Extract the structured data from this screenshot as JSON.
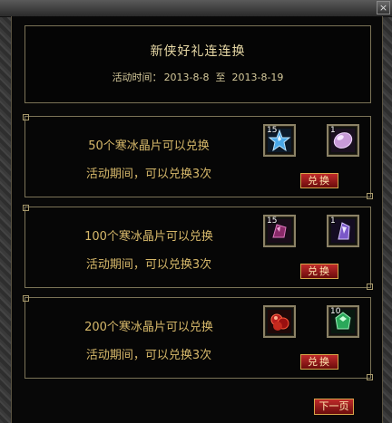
{
  "window": {
    "close_symbol": "×"
  },
  "header": {
    "title": "新侠好礼连连换",
    "period_label": "活动时间：",
    "start_date": "2013-8-8",
    "separator": "至",
    "end_date": "2013-8-19"
  },
  "offers": [
    {
      "line1": "50个寒冰晶片可以兑换",
      "line2": "活动期间，可以兑换3次",
      "cost_item": {
        "count": "15",
        "icon": "blue-star-crystal-icon"
      },
      "reward_item": {
        "count": "1",
        "icon": "pink-oval-gem-icon"
      },
      "button_label": "兑换"
    },
    {
      "line1": "100个寒冰晶片可以兑换",
      "line2": "活动期间，可以兑换3次",
      "cost_item": {
        "count": "15",
        "icon": "purple-crystal-shard-icon"
      },
      "reward_item": {
        "count": "1",
        "icon": "violet-crystal-icon"
      },
      "button_label": "兑换"
    },
    {
      "line1": "200个寒冰晶片可以兑换",
      "line2": "活动期间，可以兑换3次",
      "cost_item": {
        "count": "",
        "icon": "red-ore-cluster-icon"
      },
      "reward_item": {
        "count": "10",
        "icon": "green-emerald-icon"
      },
      "button_label": "兑换"
    }
  ],
  "footer": {
    "next_page_label": "下一页"
  },
  "colors": {
    "text_gold": "#d6b86a",
    "button_red": "#a01c1c",
    "border_gold": "#7b7357"
  }
}
